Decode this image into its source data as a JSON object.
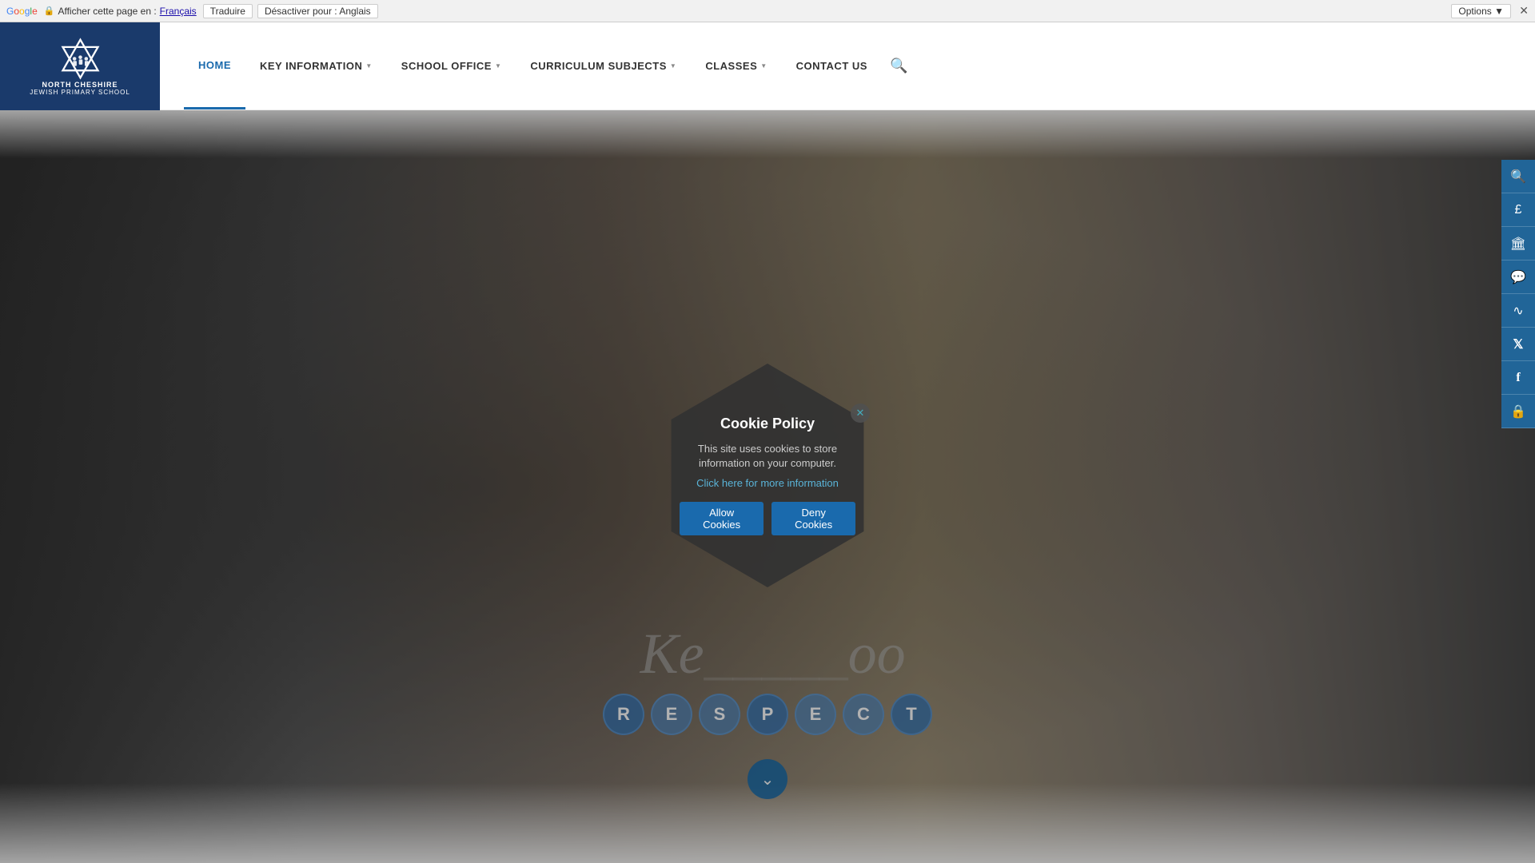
{
  "translate_bar": {
    "afficher_text": "Afficher cette page en :",
    "lang_link": "Français",
    "translate_btn": "Traduire",
    "desactiver_btn": "Désactiver pour : Anglais",
    "options_btn": "Options ▼"
  },
  "school": {
    "name_line1": "NORTH CHESHIRE",
    "name_line2": "JEWISH PRIMARY SCHOOL"
  },
  "nav": {
    "items": [
      {
        "label": "HOME",
        "active": true,
        "has_dropdown": false
      },
      {
        "label": "KEY INFORMATION",
        "active": false,
        "has_dropdown": true
      },
      {
        "label": "SCHOOL OFFICE",
        "active": false,
        "has_dropdown": true
      },
      {
        "label": "CURRICULUM SUBJECTS",
        "active": false,
        "has_dropdown": true
      },
      {
        "label": "CLASSES",
        "active": false,
        "has_dropdown": true
      },
      {
        "label": "CONTACT US",
        "active": false,
        "has_dropdown": false
      }
    ]
  },
  "cookie_modal": {
    "title": "Cookie Policy",
    "body": "This site uses cookies to store information on your computer.",
    "link_text": "Click here for more information",
    "allow_btn": "Allow Cookies",
    "deny_btn": "Deny Cookies"
  },
  "respect": {
    "letters": [
      "R",
      "E",
      "S",
      "P",
      "E",
      "C",
      "T"
    ]
  },
  "hero_cursive": "Ke___ oo",
  "right_sidebar": {
    "icons": [
      {
        "name": "search-icon",
        "symbol": "🔍"
      },
      {
        "name": "pound-icon",
        "symbol": "£"
      },
      {
        "name": "building-icon",
        "symbol": "🏛"
      },
      {
        "name": "comment-icon",
        "symbol": "💬"
      },
      {
        "name": "rss-icon",
        "symbol": "📡"
      },
      {
        "name": "twitter-icon",
        "symbol": "𝕏"
      },
      {
        "name": "facebook-icon",
        "symbol": "f"
      },
      {
        "name": "lock-icon",
        "symbol": "🔒"
      }
    ]
  },
  "colors": {
    "nav_blue": "#1a3a6b",
    "accent_blue": "#1a6aad",
    "cookie_dark": "#323232"
  }
}
